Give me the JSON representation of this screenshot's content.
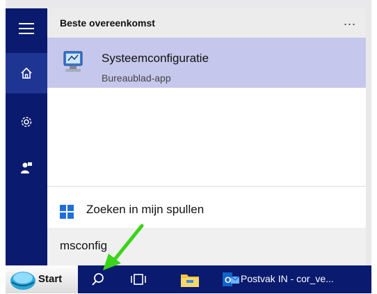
{
  "header": {
    "title": "Beste overeenkomst",
    "more_label": "..."
  },
  "best_match": {
    "name": "Systeemconfiguratie",
    "subtitle": "Bureaublad-app",
    "icon": "system-config-icon"
  },
  "my_stuff": {
    "label": "Zoeken in mijn spullen",
    "icon": "windows-logo-icon"
  },
  "search": {
    "query": "msconfig"
  },
  "rail": {
    "items": [
      {
        "icon": "hamburger-menu-icon"
      },
      {
        "icon": "home-icon",
        "active": true
      },
      {
        "icon": "gear-icon"
      },
      {
        "icon": "feedback-icon"
      }
    ]
  },
  "taskbar": {
    "start_label": "Start",
    "search_icon": "search-icon",
    "taskview_icon": "task-view-icon",
    "explorer_icon": "file-explorer-icon",
    "outlook_label": "Postvak IN - cor_ve..."
  },
  "colors": {
    "rail": "#0a1a6e",
    "rail_active": "#1e3594",
    "result_highlight": "#c6c7ec",
    "annotation_arrow": "#3ad41a"
  }
}
